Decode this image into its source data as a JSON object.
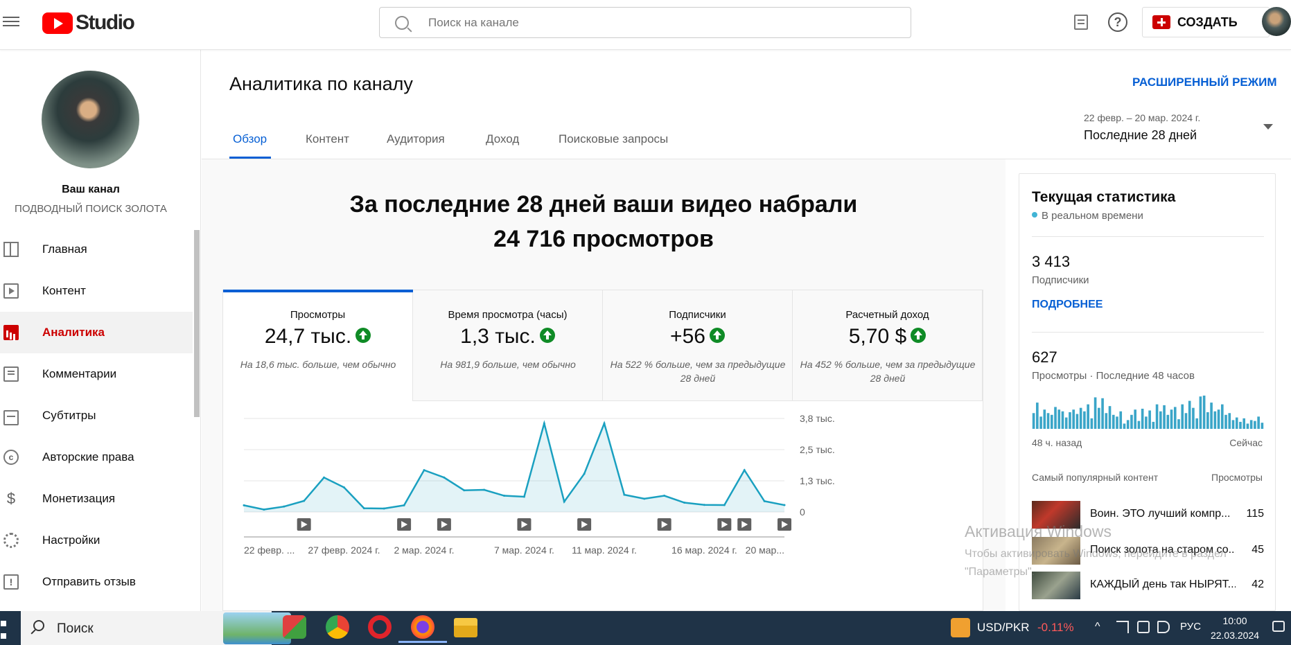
{
  "header": {
    "logo_text": "Studio",
    "search_placeholder": "Поиск на канале",
    "create_label": "СОЗДАТЬ",
    "help_glyph": "?"
  },
  "sidebar": {
    "channel_label": "Ваш канал",
    "channel_name": "ПОДВОДНЫЙ ПОИСК ЗОЛОТА",
    "items": [
      {
        "label": "Главная",
        "icon": "dashboard-icon",
        "active": false
      },
      {
        "label": "Контент",
        "icon": "content-icon",
        "active": false
      },
      {
        "label": "Аналитика",
        "icon": "analytics-icon",
        "active": true
      },
      {
        "label": "Комментарии",
        "icon": "comments-icon",
        "active": false
      },
      {
        "label": "Субтитры",
        "icon": "subtitles-icon",
        "active": false
      },
      {
        "label": "Авторские права",
        "icon": "copyright-icon",
        "active": false
      },
      {
        "label": "Монетизация",
        "icon": "monetization-icon",
        "active": false
      },
      {
        "label": "Настройки",
        "icon": "settings-icon",
        "active": false
      },
      {
        "label": "Отправить отзыв",
        "icon": "feedback-icon",
        "active": false
      }
    ]
  },
  "main": {
    "title": "Аналитика по каналу",
    "advanced_mode": "РАСШИРЕННЫЙ РЕЖИМ",
    "tabs": [
      "Обзор",
      "Контент",
      "Аудитория",
      "Доход",
      "Поисковые запросы"
    ],
    "date_range": "22 февр. – 20 мар. 2024 г.",
    "date_preset": "Последние 28 дней",
    "headline_line1": "За последние 28 дней ваши видео набрали",
    "headline_line2": "24 716 просмотров",
    "metrics": [
      {
        "title": "Просмотры",
        "value": "24,7 тыс.",
        "note": "На 18,6 тыс. больше, чем обычно"
      },
      {
        "title": "Время просмотра (часы)",
        "value": "1,3 тыс.",
        "note": "На 981,9 больше, чем обычно"
      },
      {
        "title": "Подписчики",
        "value": "+56",
        "note": "На 522 % больше, чем за предыдущие 28 дней"
      },
      {
        "title": "Расчетный доход",
        "value": "5,70 $",
        "note": "На 452 % больше, чем за предыдущие 28 дней"
      }
    ]
  },
  "chart_data": [
    {
      "type": "area",
      "series": [
        {
          "values": [
            270,
            100,
            220,
            450,
            1400,
            1000,
            150,
            140,
            270,
            1700,
            1400,
            880,
            900,
            660,
            620,
            3600,
            420,
            1550,
            3600,
            700,
            540,
            660,
            380,
            290,
            280,
            1700,
            440,
            280
          ]
        }
      ],
      "ylim": [
        0,
        3800
      ],
      "yticks": [
        "0",
        "1,3 тыс.",
        "2,5 тыс.",
        "3,8 тыс."
      ],
      "ytick_values": [
        0,
        1266,
        2533,
        3800
      ],
      "xlabels": [
        "22 февр. ...",
        "27 февр. 2024 г.",
        "2 мар. 2024 г.",
        "7 мар. 2024 г.",
        "11 мар. 2024 г.",
        "16 мар. 2024 г.",
        "20 мар..."
      ],
      "xlabel_days": [
        0,
        5,
        9,
        14,
        18,
        23,
        27
      ],
      "video_markers_days": [
        3,
        8,
        10,
        14,
        17,
        21,
        24,
        25,
        27
      ],
      "color": "#1aa0c0",
      "grid": true
    },
    {
      "type": "bar",
      "title": "Просмотры · Последние 48 часов",
      "values": [
        18,
        30,
        14,
        22,
        18,
        16,
        25,
        22,
        20,
        13,
        19,
        22,
        17,
        24,
        20,
        28,
        12,
        36,
        24,
        35,
        18,
        26,
        16,
        14,
        20,
        6,
        10,
        16,
        22,
        9,
        23,
        14,
        21,
        8,
        28,
        20,
        27,
        16,
        22,
        25,
        11,
        28,
        18,
        32,
        24,
        12,
        37,
        38,
        19,
        30,
        20,
        22,
        28,
        16,
        18,
        10,
        13,
        8,
        12,
        6,
        10,
        9,
        14,
        7
      ],
      "xlabels": [
        "48 ч. назад",
        "Сейчас"
      ],
      "color": "#3aa5c8"
    }
  ],
  "right_panel": {
    "title": "Текущая статистика",
    "live": "В реальном времени",
    "subscribers_value": "3 413",
    "subscribers_label": "Подписчики",
    "more_link": "ПОДРОБНЕЕ",
    "views_value": "627",
    "views_label": "Просмотры · Последние 48 часов",
    "axis_left": "48 ч. назад",
    "axis_right": "Сейчас",
    "top_header": "Самый популярный контент",
    "top_header_right": "Просмотры",
    "top_items": [
      {
        "title": "Воин. ЭТО лучший компр...",
        "views": "115"
      },
      {
        "title": "Поиск золота на старом со...",
        "views": "45"
      },
      {
        "title": "КАЖДЫЙ день так НЫРЯТ...",
        "views": "42"
      }
    ]
  },
  "watermark": {
    "line1": "Активация Windows",
    "line2": "Чтобы активировать Windows, перейдите в раздел \"Параметры\"."
  },
  "taskbar": {
    "search_label": "Поиск",
    "ticker": "USD/PKR",
    "ticker_change": "-0.11%",
    "lang": "РУС",
    "time": "10:00",
    "date": "22.03.2024"
  }
}
